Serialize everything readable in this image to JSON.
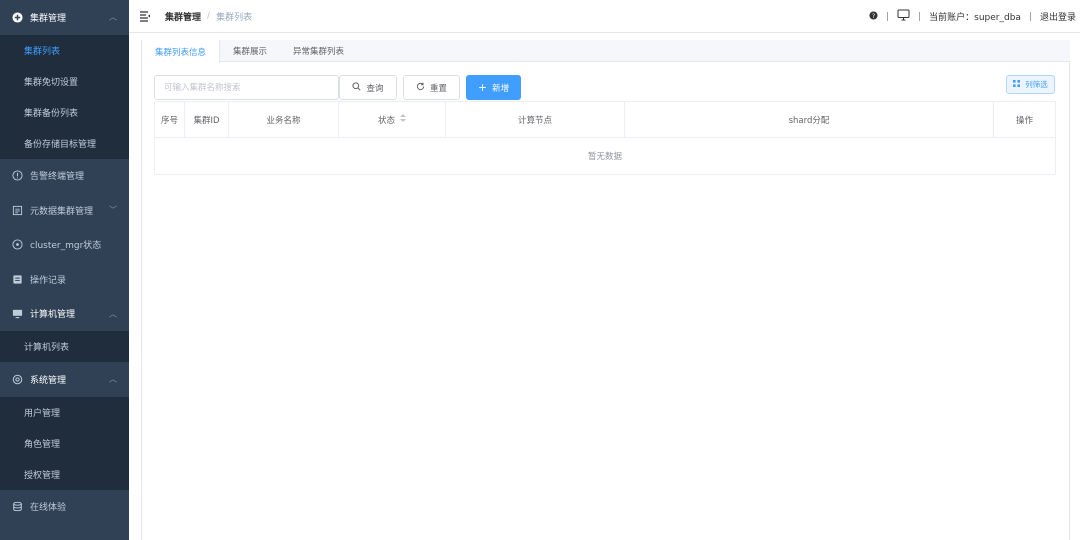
{
  "sidebar": {
    "cluster_menu": {
      "label": "集群管理",
      "icon": "plus-circle-icon"
    },
    "cluster_sub": [
      "集群列表",
      "集群免切设置",
      "集群备份列表",
      "备份存储目标管理"
    ],
    "alarm_menu": {
      "label": "告警终端管理",
      "icon": "info-circle-icon"
    },
    "metadata_menu": {
      "label": "元数据集群管理",
      "icon": "database-icon"
    },
    "mgr_menu": {
      "label": "cluster_mgr状态",
      "icon": "compass-icon"
    },
    "oplog_menu": {
      "label": "操作记录",
      "icon": "log-icon"
    },
    "machine_menu": {
      "label": "计算机管理",
      "icon": "monitor-icon"
    },
    "machine_sub": [
      "计算机列表"
    ],
    "system_menu": {
      "label": "系统管理",
      "icon": "settings-icon"
    },
    "system_sub": [
      "用户管理",
      "角色管理",
      "授权管理"
    ],
    "online_menu": {
      "label": "在线体验",
      "icon": "cylinder-icon"
    }
  },
  "header": {
    "breadcrumb": [
      "集群管理",
      "集群列表"
    ],
    "account_label": "当前账户：super_dba",
    "logout_label": "退出登录"
  },
  "tabs": [
    "集群列表信息",
    "集群展示",
    "异常集群列表"
  ],
  "toolbar": {
    "search_placeholder": "可输入集群名称搜索",
    "search_value": "",
    "query_label": "查询",
    "reset_label": "重置",
    "add_label": "新增",
    "column_filter_label": "列筛选"
  },
  "table": {
    "columns": [
      "序号",
      "集群ID",
      "业务名称",
      "状态",
      "计算节点",
      "shard分配",
      "操作"
    ],
    "empty_text": "暂无数据"
  },
  "colors": {
    "sidebar_bg": "#304156",
    "submenu_bg": "#1f2d3d",
    "accent": "#409eff"
  }
}
